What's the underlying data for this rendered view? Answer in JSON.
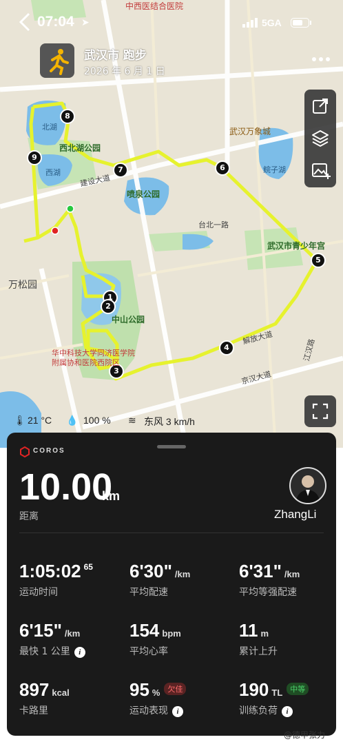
{
  "status_bar": {
    "time": "07:04",
    "network": "5GA"
  },
  "header": {
    "title": "武汉市 跑步",
    "date": "2026 年 6 月 1 日"
  },
  "map": {
    "labels": {
      "hospital": "中西医结合医院",
      "north_lake": "北湖",
      "west_north_lake_park": "西北湖公园",
      "west_lake": "西湖",
      "construction_ave": "建设大道",
      "fountain_park": "喷泉公园",
      "wanxiang": "武汉万象城",
      "children_palace": "武汉市青少年宫",
      "wansong": "万松园",
      "zhongshan_park": "中山公园",
      "union_hospital": "华中科技大学同济医学院附属协和医院西院区",
      "jiefang_ave": "解放大道",
      "jingnan_ave": "京汉大道",
      "jianghan_rd": "江汉路",
      "guanzi_lake": "鲩子湖",
      "taibei_rd": "台北一路"
    },
    "route_color": "#e6f22e",
    "markers": [
      "1",
      "2",
      "3",
      "4",
      "5",
      "6",
      "7",
      "8",
      "9"
    ]
  },
  "weather": {
    "temperature": "21 °C",
    "humidity": "100 %",
    "wind": "东风 3 km/h"
  },
  "panel": {
    "brand": "COROS",
    "distance_value": "10.00",
    "distance_unit": "km",
    "distance_label": "距离",
    "user_name": "ZhangLi",
    "metrics": [
      {
        "value": "1:05:02",
        "sup": "65",
        "unit": "",
        "label": "运动时间"
      },
      {
        "value": "6'30\"",
        "unit": "/km",
        "label": "平均配速"
      },
      {
        "value": "6'31\"",
        "unit": "/km",
        "label": "平均等强配速"
      },
      {
        "value": "6'15\"",
        "unit": "/km",
        "label": "最快 1 公里"
      },
      {
        "value": "154",
        "unit": "bpm",
        "label": "平均心率"
      },
      {
        "value": "11",
        "unit": "m",
        "label": "累计上升"
      },
      {
        "value": "897",
        "unit": "kcal",
        "label": "卡路里"
      },
      {
        "value": "95",
        "unit": "%",
        "badge": "欠佳",
        "label": "运动表现"
      },
      {
        "value": "190",
        "unit": "TL",
        "badge": "中等",
        "label": "训练负荷"
      }
    ]
  },
  "watermark": "@德甲张力"
}
